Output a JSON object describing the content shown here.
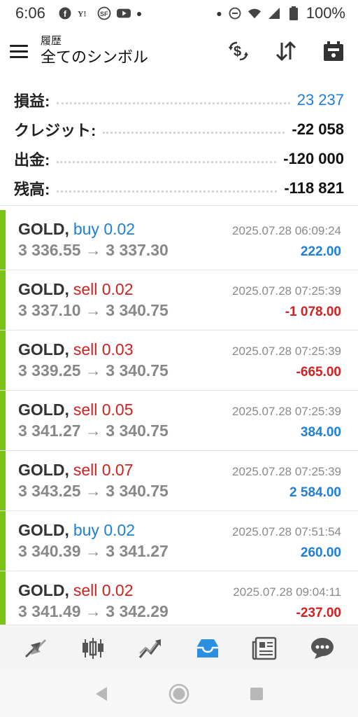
{
  "status_bar": {
    "time": "6:06",
    "icons": [
      "facebook-icon",
      "yahoo-icon",
      "news-icon",
      "youtube-icon",
      "dot-icon"
    ],
    "right_icons": [
      "dot-icon",
      "dnd-icon",
      "wifi-icon",
      "signal-icon",
      "battery-icon"
    ],
    "battery": "100%"
  },
  "app_bar": {
    "title": "履歴",
    "subtitle": "全てのシンボル"
  },
  "summary": [
    {
      "label": "損益:",
      "value": "23 237",
      "color": "#1e7fd8"
    },
    {
      "label": "クレジット:",
      "value": "-22 058",
      "color": "#111111"
    },
    {
      "label": "出金:",
      "value": "-120 000",
      "color": "#111111"
    },
    {
      "label": "残高:",
      "value": "-118 821",
      "color": "#111111"
    }
  ],
  "deals": [
    {
      "symbol": "GOLD",
      "side": "buy",
      "volume": "buy 0.02",
      "time": "2025.07.28 06:09:24",
      "prices": "3 336.55 → 3 337.30",
      "profit": "222.00"
    },
    {
      "symbol": "GOLD",
      "side": "sell",
      "volume": "sell 0.02",
      "time": "2025.07.28 07:25:39",
      "prices": "3 337.10 → 3 340.75",
      "profit": "-1 078.00"
    },
    {
      "symbol": "GOLD",
      "side": "sell",
      "volume": "sell 0.03",
      "time": "2025.07.28 07:25:39",
      "prices": "3 339.25 → 3 340.75",
      "profit": "-665.00"
    },
    {
      "symbol": "GOLD",
      "side": "sell",
      "volume": "sell 0.05",
      "time": "2025.07.28 07:25:39",
      "prices": "3 341.27 → 3 340.75",
      "profit": "384.00"
    },
    {
      "symbol": "GOLD",
      "side": "sell",
      "volume": "sell 0.07",
      "time": "2025.07.28 07:25:39",
      "prices": "3 343.25 → 3 340.75",
      "profit": "2 584.00"
    },
    {
      "symbol": "GOLD",
      "side": "buy",
      "volume": "buy 0.02",
      "time": "2025.07.28 07:51:54",
      "prices": "3 340.39 → 3 341.27",
      "profit": "260.00"
    },
    {
      "symbol": "GOLD",
      "side": "sell",
      "volume": "sell 0.02",
      "time": "2025.07.28 09:04:11",
      "prices": "3 341.49 → 3 342.29",
      "profit": "-237.00"
    }
  ],
  "colors": {
    "accent_green": "#7cc414",
    "buy_blue": "#1e7fd8",
    "sell_red": "#d32020"
  },
  "bottom_nav": [
    "quotes-icon",
    "chart-icon",
    "trade-icon",
    "history-icon",
    "news-icon",
    "chat-icon"
  ],
  "bottom_nav_active": "history-icon"
}
